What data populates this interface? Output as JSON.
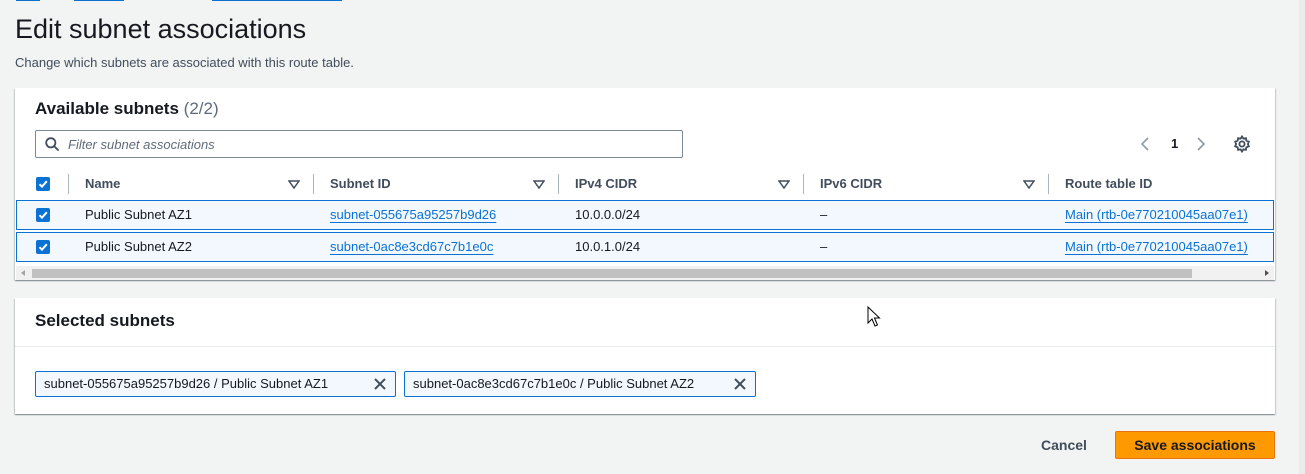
{
  "page": {
    "title": "Edit subnet associations",
    "subtitle": "Change which subnets are associated with this route table."
  },
  "available": {
    "title": "Available subnets",
    "count": "(2/2)",
    "filter_placeholder": "Filter subnet associations",
    "filter_value": "",
    "pagination": {
      "current_page": "1"
    },
    "columns": [
      "Name",
      "Subnet ID",
      "IPv4 CIDR",
      "IPv6 CIDR",
      "Route table ID"
    ],
    "rows": [
      {
        "selected": true,
        "name": "Public Subnet AZ1",
        "subnet_id": "subnet-055675a95257b9d26",
        "ipv4_cidr": "10.0.0.0/24",
        "ipv6_cidr": "–",
        "route_table_id": "Main (rtb-0e770210045aa07e1)"
      },
      {
        "selected": true,
        "name": "Public Subnet AZ2",
        "subnet_id": "subnet-0ac8e3cd67c7b1e0c",
        "ipv4_cidr": "10.0.1.0/24",
        "ipv6_cidr": "–",
        "route_table_id": "Main (rtb-0e770210045aa07e1)"
      }
    ]
  },
  "selected": {
    "title": "Selected subnets",
    "tokens": [
      "subnet-055675a95257b9d26 / Public Subnet AZ1",
      "subnet-0ac8e3cd67c7b1e0c / Public Subnet AZ2"
    ]
  },
  "actions": {
    "cancel_label": "Cancel",
    "save_label": "Save associations"
  },
  "colors": {
    "accent": "#0972d3",
    "primary_button": "#ff9900",
    "background": "#f2f3f3"
  },
  "icons": [
    "search-icon",
    "chevron-left-icon",
    "chevron-right-icon",
    "gear-icon",
    "sort-caret-icon",
    "checkbox-checked-icon",
    "close-icon",
    "mouse-cursor-icon"
  ]
}
